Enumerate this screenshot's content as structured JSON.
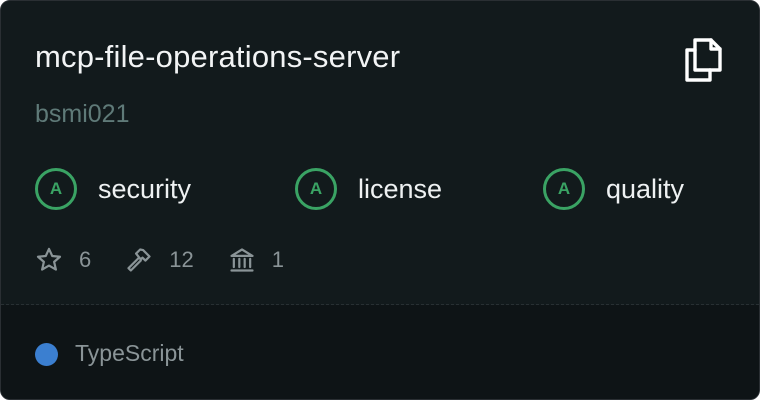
{
  "server": {
    "name": "mcp-file-operations-server",
    "author": "bsmi021"
  },
  "grades": [
    {
      "letter": "A",
      "label": "security"
    },
    {
      "letter": "A",
      "label": "license"
    },
    {
      "letter": "A",
      "label": "quality"
    }
  ],
  "stats": {
    "stars": "6",
    "tools": "12",
    "resources": "1"
  },
  "language": {
    "name": "TypeScript",
    "color": "#3b7fd0"
  },
  "colors": {
    "grade_accent": "#3aa364",
    "card_background": "#121a1c"
  },
  "icons": {
    "copy": "copy-icon",
    "stars": "star-icon",
    "tools": "hammer-icon",
    "resources": "bank-icon"
  }
}
